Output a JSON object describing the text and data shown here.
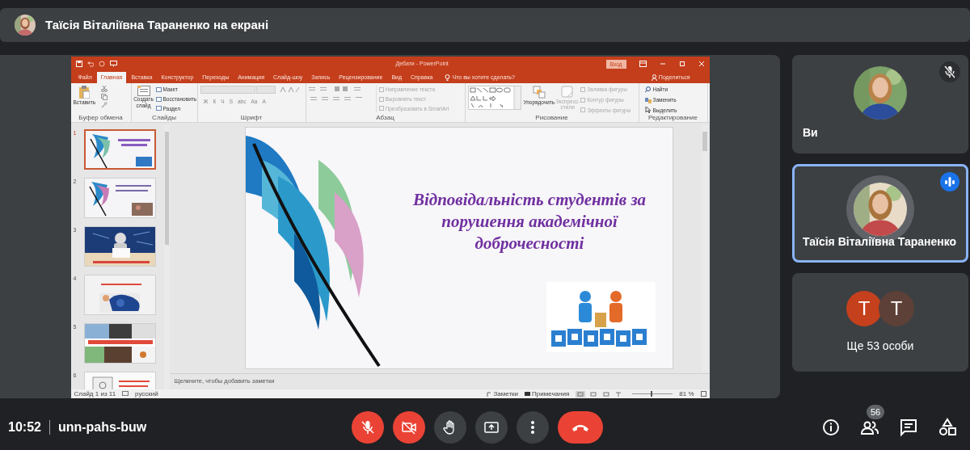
{
  "meeting_header": {
    "text": "Таїсія Віталіївна Тараненко на екрані"
  },
  "powerpoint": {
    "title": "Дебати - PowerPoint",
    "sign_in": "Вход",
    "tabs": [
      {
        "label": "Файл",
        "selected": false
      },
      {
        "label": "Главная",
        "selected": true
      },
      {
        "label": "Вставка",
        "selected": false
      },
      {
        "label": "Конструктор",
        "selected": false
      },
      {
        "label": "Переходы",
        "selected": false
      },
      {
        "label": "Анимация",
        "selected": false
      },
      {
        "label": "Слайд-шоу",
        "selected": false
      },
      {
        "label": "Запись",
        "selected": false
      },
      {
        "label": "Рецензирование",
        "selected": false
      },
      {
        "label": "Вид",
        "selected": false
      },
      {
        "label": "Справка",
        "selected": false
      }
    ],
    "tell_me": "Что вы хотите сделать?",
    "share": "Поделиться",
    "clipboard": {
      "paste": "Вставить",
      "label": "Буфер обмена"
    },
    "slides_group": {
      "new_slide": "Создать слайд",
      "layout": "Макет",
      "reset": "Восстановить",
      "section": "Раздел",
      "label": "Слайды"
    },
    "font_group": {
      "buttons": [
        "Ж",
        "К",
        "Ч",
        "S",
        "abc",
        "Aa",
        "A"
      ],
      "label": "Шрифт"
    },
    "paragraph_group": {
      "items": [
        {
          "label": "Направление текста",
          "disabled": true
        },
        {
          "label": "Выровнять текст",
          "disabled": true
        },
        {
          "label": "Преобразовать в SmartArt",
          "disabled": true
        }
      ],
      "label": "Абзац"
    },
    "drawing_group": {
      "arrange": "Упорядочить",
      "quick_styles": "Экспресс-стили",
      "items": [
        {
          "label": "Заливка фигуры",
          "disabled": true
        },
        {
          "label": "Контур фигуры",
          "disabled": true
        },
        {
          "label": "Эффекты фигуры",
          "disabled": true
        }
      ],
      "label": "Рисование"
    },
    "editing_group": {
      "items": [
        "Найти",
        "Заменить",
        "Выделить"
      ],
      "label": "Редактирование"
    },
    "thumbnails": [
      {
        "number": "1",
        "selected": true
      },
      {
        "number": "2",
        "selected": false
      },
      {
        "number": "3",
        "selected": false
      },
      {
        "number": "4",
        "selected": false
      },
      {
        "number": "5",
        "selected": false
      },
      {
        "number": "6",
        "selected": false
      }
    ],
    "slide_title": "Відповідальність студентів за порушення академічної доброчесності",
    "notes": "Щелкните, чтобы добавить заметки",
    "status": {
      "slide": "Слайд 1 из 11",
      "language": "русский",
      "notes": "Заметки",
      "comments": "Примечания",
      "zoom": "81 %"
    },
    "zoom_slider": {
      "level": 0.45
    }
  },
  "tiles": [
    {
      "name": "Ви",
      "muted": true,
      "speaking": false
    },
    {
      "name": "Таїсія Віталіївна Тараненко",
      "muted": false,
      "speaking": true
    }
  ],
  "others": {
    "avatars": [
      {
        "letter": "T",
        "color": "#c5401c"
      },
      {
        "letter": "T",
        "color": "#5d4037"
      }
    ],
    "label": "Ще 53 особи"
  },
  "footer": {
    "time": "10:52",
    "code": "unn-pahs-buw",
    "controls": [
      {
        "kind": "mic",
        "on": false
      },
      {
        "kind": "camera",
        "on": false
      },
      {
        "kind": "hand"
      },
      {
        "kind": "present"
      },
      {
        "kind": "more"
      },
      {
        "kind": "end"
      }
    ],
    "tools": [
      {
        "kind": "info"
      },
      {
        "kind": "people",
        "badge": "56"
      },
      {
        "kind": "chat"
      },
      {
        "kind": "activities"
      }
    ]
  }
}
